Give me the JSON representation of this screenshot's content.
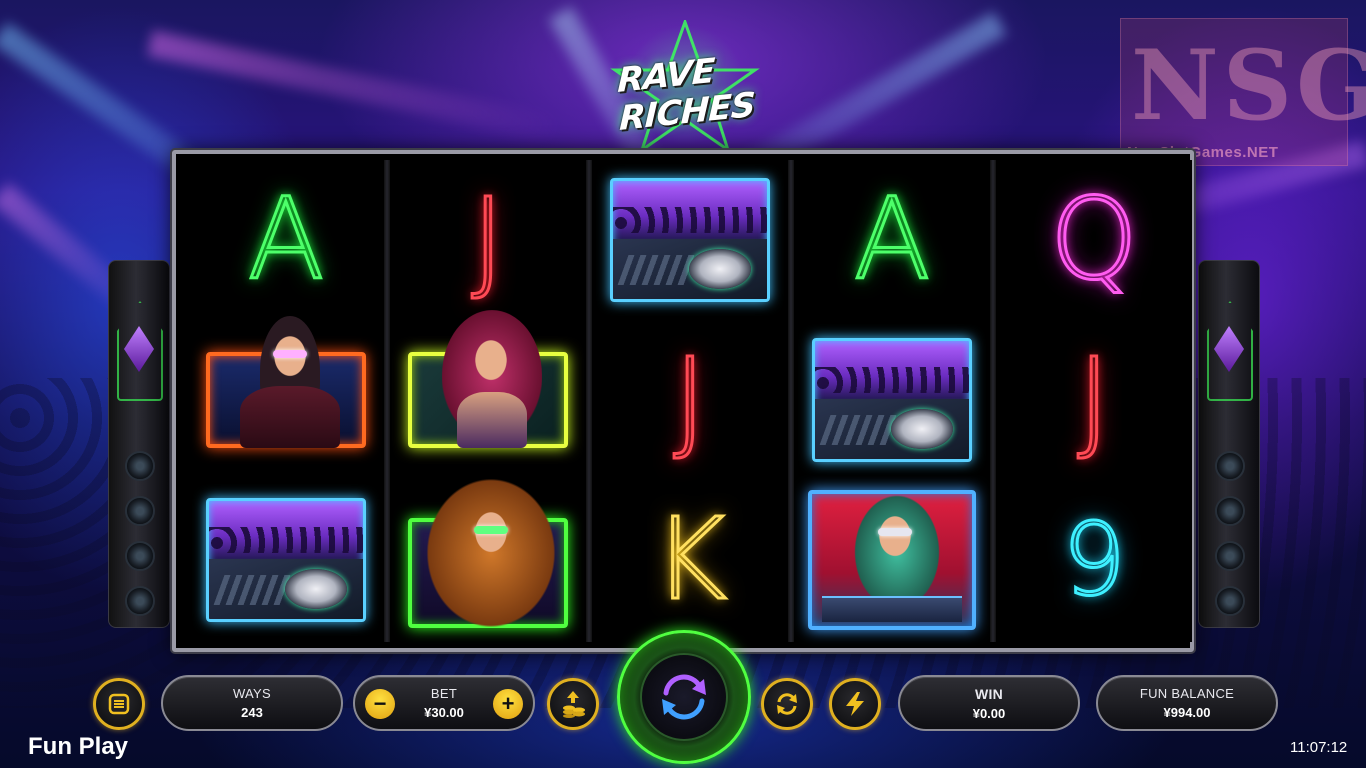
{
  "game": {
    "logo_line1": "RAVE",
    "logo_line2": "RICHES"
  },
  "watermark": {
    "letters": "NSG",
    "url": "NewSlotGames.NET"
  },
  "reels": [
    [
      "A",
      "dj-male",
      "dj-deck"
    ],
    [
      "J",
      "dancer-red-hair",
      "dancer-blonde"
    ],
    [
      "dj-deck",
      "J",
      "K"
    ],
    [
      "A",
      "dj-deck",
      "dj-female-headphones"
    ],
    [
      "Q",
      "J",
      "9"
    ]
  ],
  "controls": {
    "menu_icon": "menu-icon",
    "ways_label": "WAYS",
    "ways_value": "243",
    "bet_label": "BET",
    "bet_value": "¥30.00",
    "minus_symbol": "−",
    "plus_symbol": "+",
    "coin_icon": "coin-stack-icon",
    "spin_icon": "spin-arrows-icon",
    "autoplay_icon": "autoplay-icon",
    "turbo_icon": "lightning-icon",
    "win_label": "WIN",
    "win_value": "¥0.00",
    "balance_label": "FUN BALANCE",
    "balance_value": "¥994.00"
  },
  "footer": {
    "mode": "Fun Play",
    "time": "11:07:12"
  },
  "colors": {
    "accent_gold": "#e0b020",
    "spin_green": "#50ff40",
    "neon_green": "#3cff5a",
    "neon_red": "#ff4a55",
    "neon_pink": "#ff5cf0",
    "neon_yellow": "#ffe060",
    "neon_cyan": "#3ef0ff"
  }
}
